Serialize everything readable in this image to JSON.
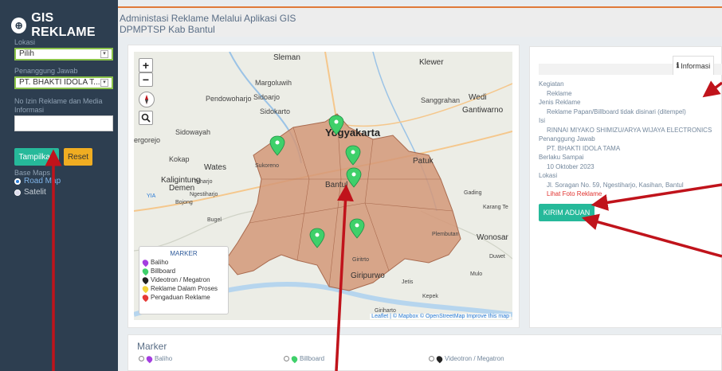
{
  "sidebar": {
    "app_title": "GIS REKLAME",
    "logo_icon": "map-logo-icon",
    "lokasi_label": "Lokasi",
    "lokasi_value": "Pilih",
    "penanggung_label": "Penanggung Jawab",
    "penanggung_value": "PT. BHAKTI IDOLA T...",
    "noizin_label": "No Izin Reklame dan Media Informasi",
    "noizin_value": "",
    "show_button": "Tampilkan",
    "reset_button": "Reset",
    "basemaps_label": "Base Maps",
    "basemaps": [
      {
        "label": "Road Map",
        "selected": true
      },
      {
        "label": "Satelit",
        "selected": false
      }
    ]
  },
  "header": {
    "line1": "Administasi Reklame Melalui Aplikasi GIS",
    "line2": "DPMPTSP Kab Bantul"
  },
  "map": {
    "zoom_in": "+",
    "zoom_out": "−",
    "labels": {
      "sleman": "Sleman",
      "klewer": "Klewer",
      "margoluwih": "Margoluwih",
      "sidoarjo": "Sidoarjo",
      "sidokarto": "Sidokarto",
      "sanggrahan": "Sanggrahan",
      "wedi": "Wedi",
      "gantiwarno": "Gantiwarno",
      "pendowoharjo": "Pendowoharjo",
      "sidowayah": "Sidowayah",
      "yogyakarta": "Yogyakarta",
      "gergorejo": "ergorejo",
      "kokap": "Kokap",
      "wates": "Wates",
      "sukoreno": "Sukoreno",
      "kaligintung": "Kaligintung",
      "triharjo": "Triharjo",
      "demen": "Demen",
      "ngestiharjo": "Ngestiharjo",
      "bojong": "Bojong",
      "bugel": "Bugel",
      "bantul": "Bantul",
      "patuk": "Patuk",
      "gading": "Gading",
      "karangte": "Karang Te",
      "plembutan": "Plembutan",
      "wonosari": "Wonosar",
      "duwet": "Duwet",
      "girirto": "Giritrto",
      "giripurwo": "Giripurwo",
      "mulo": "Mulo",
      "jetis": "Jetis",
      "kepek": "Kepek",
      "yia": "YIA",
      "giriharjo": "Giriharto"
    },
    "attribution": "Leaflet | © Mapbox © OpenStreetMap Improve this map",
    "legend": {
      "title": "MARKER",
      "items": [
        {
          "label": "Baliho",
          "color": "#a43de0"
        },
        {
          "label": "Billboard",
          "color": "#3fd06a"
        },
        {
          "label": "Videotron / Megatron",
          "color": "#222222"
        },
        {
          "label": "Reklame Dalam Proses",
          "color": "#f2d33a"
        },
        {
          "label": "Pengaduan Reklame",
          "color": "#e53935"
        }
      ]
    },
    "region_color": "#d49878"
  },
  "info": {
    "tab_label": "Informasi",
    "tab_icon": "info-icon",
    "kegiatan_label": "Kegiatan",
    "kegiatan_value": "Reklame",
    "jenis_label": "Jenis Reklame",
    "jenis_value": "Reklame Papan/Billboard tidak disinari (ditempel)",
    "isi_label": "Isi",
    "isi_value": "RINNAI MIYAKO SHIMIZU/ARYA WIJAYA ELECTRONICS",
    "pj_label": "Penanggung Jawab",
    "pj_value": "PT. BHAKTI IDOLA TAMA",
    "berlaku_label": "Berlaku Sampai",
    "berlaku_value": "10 Oktober 2023",
    "lokasi_label": "Lokasi",
    "lokasi_value": "Jl. Soragan No. 59, Ngestiharjo, Kasihan, Bantul",
    "foto_link": "Lihat Foto Reklame",
    "aduan_button": "KIRIM ADUAN"
  },
  "markers_section": {
    "title": "Marker",
    "items": [
      {
        "label": "Baliho",
        "color": "#a43de0"
      },
      {
        "label": "Billboard",
        "color": "#3fd06a"
      },
      {
        "label": "Videotron / Megatron",
        "color": "#222222"
      }
    ]
  },
  "annotation_color": "#c0131b"
}
